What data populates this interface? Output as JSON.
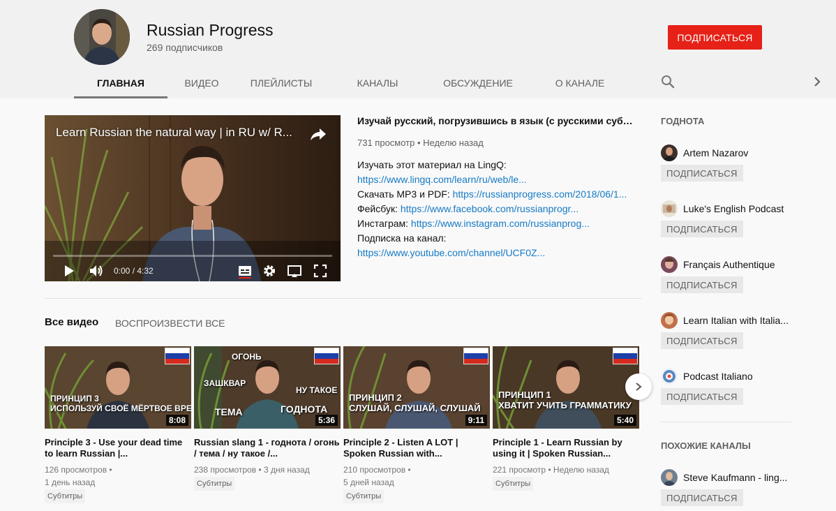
{
  "channel": {
    "name": "Russian Progress",
    "subscribers": "269 подписчиков",
    "subscribe_label": "ПОДПИСАТЬСЯ"
  },
  "tabs": [
    {
      "label": "ГЛАВНАЯ",
      "active": true
    },
    {
      "label": "ВИДЕО",
      "active": false
    },
    {
      "label": "ПЛЕЙЛИСТЫ",
      "active": false
    },
    {
      "label": "КАНАЛЫ",
      "active": false
    },
    {
      "label": "ОБСУЖДЕНИЕ",
      "active": false
    },
    {
      "label": "О КАНАЛЕ",
      "active": false
    }
  ],
  "icons": {
    "search": "search-icon",
    "next_tab": "chevron-right-icon",
    "share": "share-icon",
    "play": "play-icon",
    "volume": "volume-icon",
    "subtitles": "subtitles-icon",
    "settings": "gear-icon",
    "cast": "cast-icon",
    "fullscreen": "fullscreen-icon"
  },
  "featured": {
    "player_title": "Learn Russian the natural way | in RU w/ R...",
    "time": "0:00 / 4:32",
    "title": "Изучай русский, погрузившись в язык (с русскими субтит...",
    "meta": "731 просмотр • Неделю назад",
    "desc": [
      {
        "label": "Изучать этот материал на LingQ:",
        "link": ""
      },
      {
        "label": "",
        "link": "https://www.lingq.com/learn/ru/web/le..."
      },
      {
        "label": "Скачать MP3 и PDF: ",
        "link": "https://russianprogress.com/2018/06/1..."
      },
      {
        "label": "Фейсбук: ",
        "link": "https://www.facebook.com/russianprogr..."
      },
      {
        "label": "Инстаграм: ",
        "link": "https://www.instagram.com/russianprog..."
      },
      {
        "label": "Подписка на канал:",
        "link": ""
      },
      {
        "label": "",
        "link": "https://www.youtube.com/channel/UCF0Z..."
      }
    ]
  },
  "all_videos": {
    "heading": "Все видео",
    "play_all": "ВОСПРОИЗВЕСТИ ВСЕ",
    "items": [
      {
        "title": "Principle 3 - Use your dead time to learn Russian |...",
        "views": "126 просмотров •",
        "age": "1 день назад",
        "badge": "Субтитры",
        "duration": "8:08",
        "caption_lines": [
          "ПРИНЦИП 3",
          "ИСПОЛЬЗУЙ СВОЁ МЁРТВОЕ ВРЕМЯ"
        ],
        "words": []
      },
      {
        "title": "Russian slang 1 - годнота / огонь / тема / ну такое /...",
        "views": "238 просмотров • 3 дня назад",
        "age": "",
        "badge": "Субтитры",
        "duration": "5:36",
        "caption_lines": [],
        "words": [
          "ОГОНЬ",
          "ЗАШКВАР",
          "НУ ТАКОЕ",
          "ТЕМА",
          "ГОДНОТА"
        ]
      },
      {
        "title": "Principle 2 - Listen A LOT | Spoken Russian with...",
        "views": "210 просмотров •",
        "age": "5 дней назад",
        "badge": "Субтитры",
        "duration": "9:11",
        "caption_lines": [
          "ПРИНЦИП 2",
          "СЛУШАЙ, СЛУШАЙ, СЛУШАЙ"
        ],
        "words": []
      },
      {
        "title": "Principle 1 - Learn Russian by using it | Spoken Russian...",
        "views": "221 просмотр • Неделю назад",
        "age": "",
        "badge": "Субтитры",
        "duration": "5:40",
        "caption_lines": [
          "ПРИНЦИП 1",
          "ХВАТИТ УЧИТЬ ГРАММАТИКУ"
        ],
        "words": []
      }
    ]
  },
  "sidebar": {
    "featured_heading": "ГОДНОТА",
    "featured_channels": [
      {
        "name": "Artem Nazarov",
        "subscribe": "ПОДПИСАТЬСЯ",
        "color": "#3b2f2a"
      },
      {
        "name": "Luke's English Podcast",
        "subscribe": "ПОДПИСАТЬСЯ",
        "color": "#c9b7a0"
      },
      {
        "name": "Français Authentique",
        "subscribe": "ПОДПИСАТЬСЯ",
        "color": "#7a4a5a"
      },
      {
        "name": "Learn Italian with Italia...",
        "subscribe": "ПОДПИСАТЬСЯ",
        "color": "#c0714d"
      },
      {
        "name": "Podcast Italiano",
        "subscribe": "ПОДПИСАТЬСЯ",
        "color": "#5b88c0"
      }
    ],
    "related_heading": "ПОХОЖИЕ КАНАЛЫ",
    "related_channels": [
      {
        "name": "Steve Kaufmann - ling...",
        "subscribe": "ПОДПИСАТЬСЯ",
        "color": "#6f7f91"
      }
    ]
  },
  "colors": {
    "subscribe_red": "#e62117",
    "link_blue": "#167ac6",
    "header_bg": "#f1f1f1"
  }
}
